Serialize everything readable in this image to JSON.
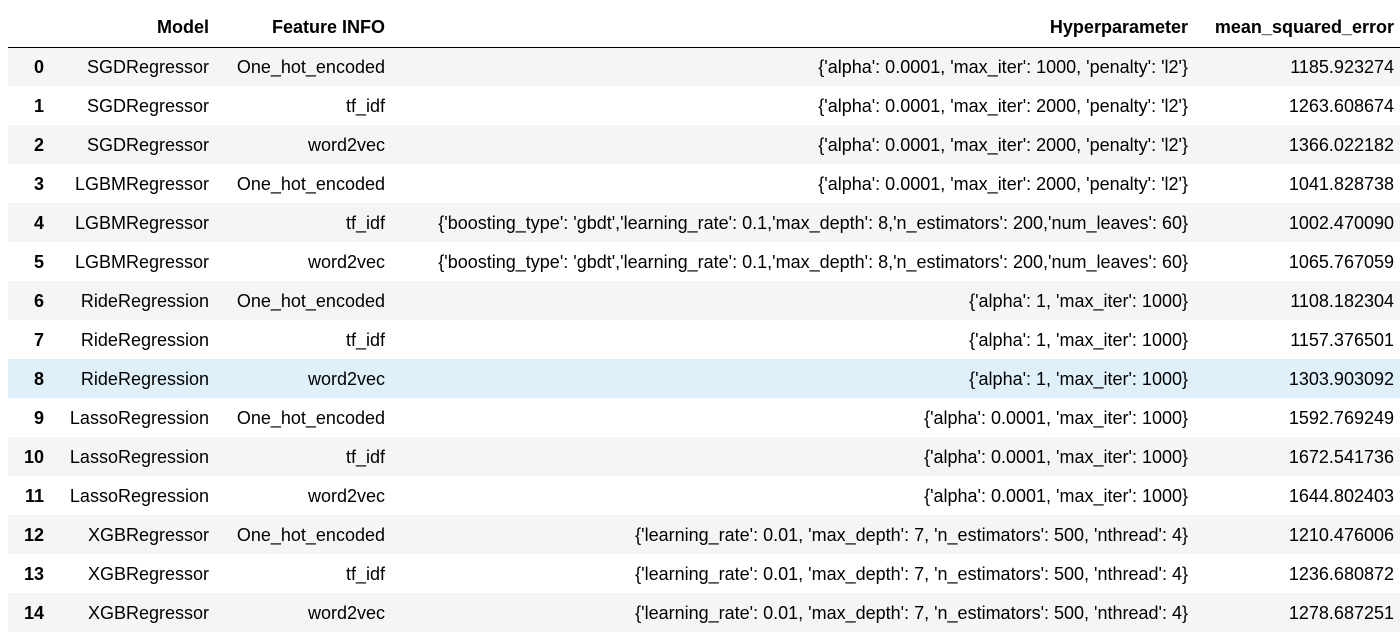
{
  "table": {
    "headers": {
      "index": "",
      "model": "Model",
      "feature": "Feature INFO",
      "hyperparameter": "Hyperparameter",
      "mse": "mean_squared_error"
    },
    "rows": [
      {
        "index": "0",
        "model": "SGDRegressor",
        "feature": "One_hot_encoded",
        "hyperparameter": "{'alpha': 0.0001, 'max_iter': 1000, 'penalty': 'l2'}",
        "mse": "1185.923274"
      },
      {
        "index": "1",
        "model": "SGDRegressor",
        "feature": "tf_idf",
        "hyperparameter": "{'alpha': 0.0001, 'max_iter': 2000, 'penalty': 'l2'}",
        "mse": "1263.608674"
      },
      {
        "index": "2",
        "model": "SGDRegressor",
        "feature": "word2vec",
        "hyperparameter": "{'alpha': 0.0001, 'max_iter': 2000, 'penalty': 'l2'}",
        "mse": "1366.022182"
      },
      {
        "index": "3",
        "model": "LGBMRegressor",
        "feature": "One_hot_encoded",
        "hyperparameter": "{'alpha': 0.0001, 'max_iter': 2000, 'penalty': 'l2'}",
        "mse": "1041.828738"
      },
      {
        "index": "4",
        "model": "LGBMRegressor",
        "feature": "tf_idf",
        "hyperparameter": "{'boosting_type': 'gbdt','learning_rate': 0.1,'max_depth': 8,'n_estimators': 200,'num_leaves': 60}",
        "mse": "1002.470090"
      },
      {
        "index": "5",
        "model": "LGBMRegressor",
        "feature": "word2vec",
        "hyperparameter": "{'boosting_type': 'gbdt','learning_rate': 0.1,'max_depth': 8,'n_estimators': 200,'num_leaves': 60}",
        "mse": "1065.767059"
      },
      {
        "index": "6",
        "model": "RideRegression",
        "feature": "One_hot_encoded",
        "hyperparameter": "{'alpha': 1, 'max_iter': 1000}",
        "mse": "1108.182304"
      },
      {
        "index": "7",
        "model": "RideRegression",
        "feature": "tf_idf",
        "hyperparameter": "{'alpha': 1, 'max_iter': 1000}",
        "mse": "1157.376501"
      },
      {
        "index": "8",
        "model": "RideRegression",
        "feature": "word2vec",
        "hyperparameter": "{'alpha': 1, 'max_iter': 1000}",
        "mse": "1303.903092"
      },
      {
        "index": "9",
        "model": "LassoRegression",
        "feature": "One_hot_encoded",
        "hyperparameter": "{'alpha': 0.0001, 'max_iter': 1000}",
        "mse": "1592.769249"
      },
      {
        "index": "10",
        "model": "LassoRegression",
        "feature": "tf_idf",
        "hyperparameter": "{'alpha': 0.0001, 'max_iter': 1000}",
        "mse": "1672.541736"
      },
      {
        "index": "11",
        "model": "LassoRegression",
        "feature": "word2vec",
        "hyperparameter": "{'alpha': 0.0001, 'max_iter': 1000}",
        "mse": "1644.802403"
      },
      {
        "index": "12",
        "model": "XGBRegressor",
        "feature": "One_hot_encoded",
        "hyperparameter": "{'learning_rate': 0.01, 'max_depth': 7, 'n_estimators': 500, 'nthread': 4}",
        "mse": "1210.476006"
      },
      {
        "index": "13",
        "model": "XGBRegressor",
        "feature": "tf_idf",
        "hyperparameter": "{'learning_rate': 0.01, 'max_depth': 7, 'n_estimators': 500, 'nthread': 4}",
        "mse": "1236.680872"
      },
      {
        "index": "14",
        "model": "XGBRegressor",
        "feature": "word2vec",
        "hyperparameter": "{'learning_rate': 0.01, 'max_depth': 7, 'n_estimators': 500, 'nthread': 4}",
        "mse": "1278.687251"
      }
    ],
    "highlighted_row_index": 8,
    "colors": {
      "odd_row_bg": "#f5f5f5",
      "even_row_bg": "#ffffff",
      "hover_row_bg": "#dff0fa",
      "header_rule": "#000000"
    }
  }
}
